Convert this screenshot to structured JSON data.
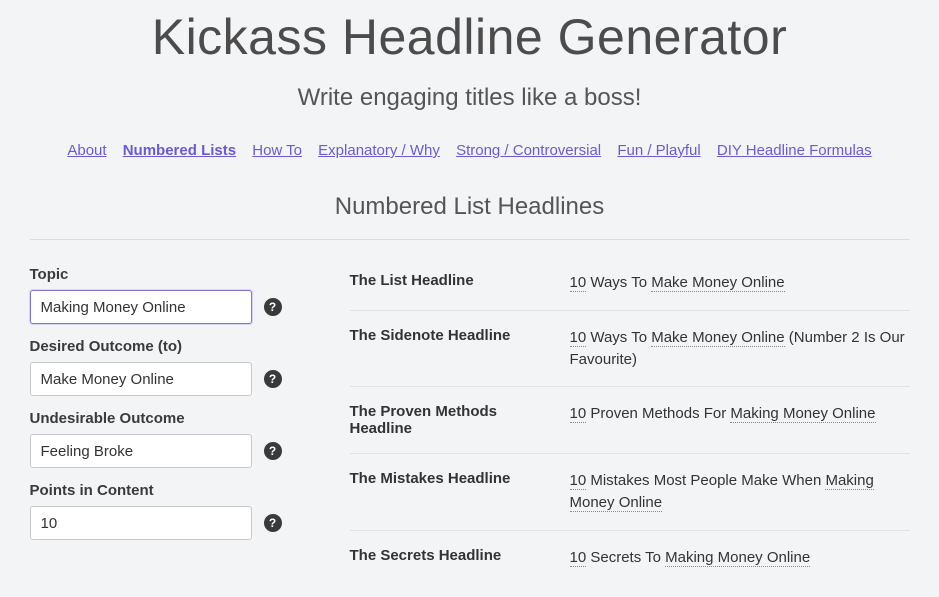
{
  "page_title": "Kickass Headline Generator",
  "tagline": "Write engaging titles like a boss!",
  "nav": {
    "about": "About",
    "numbered_lists": "Numbered Lists",
    "how_to": "How To",
    "explanatory": "Explanatory / Why",
    "strong": "Strong / Controversial",
    "fun": "Fun / Playful",
    "diy": "DIY Headline Formulas"
  },
  "section_title": "Numbered List Headlines",
  "form": {
    "topic": {
      "label": "Topic",
      "value": "Making Money Online"
    },
    "outcome": {
      "label": "Desired Outcome (to)",
      "value": "Make Money Online"
    },
    "undesirable": {
      "label": "Undesirable Outcome",
      "value": "Feeling Broke"
    },
    "points": {
      "label": "Points in Content",
      "value": "10"
    }
  },
  "results": {
    "list": {
      "label": "The List Headline",
      "points": "10",
      "t1": " Ways To ",
      "outcome": "Make Money Online"
    },
    "sidenote": {
      "label": "The Sidenote Headline",
      "points": "10",
      "t1": " Ways To ",
      "outcome": "Make Money Online",
      "t2": " (Number 2 Is Our Favourite)"
    },
    "proven": {
      "label": "The Proven Methods Headline",
      "points": "10",
      "t1": " Proven Methods For ",
      "topic": "Making Money Online"
    },
    "mistakes": {
      "label": "The Mistakes Headline",
      "points": "10",
      "t1": " Mistakes Most People Make When ",
      "topic": "Making Money Online"
    },
    "secrets": {
      "label": "The Secrets Headline",
      "points": "10",
      "t1": " Secrets To ",
      "topic": "Making Money Online"
    }
  }
}
